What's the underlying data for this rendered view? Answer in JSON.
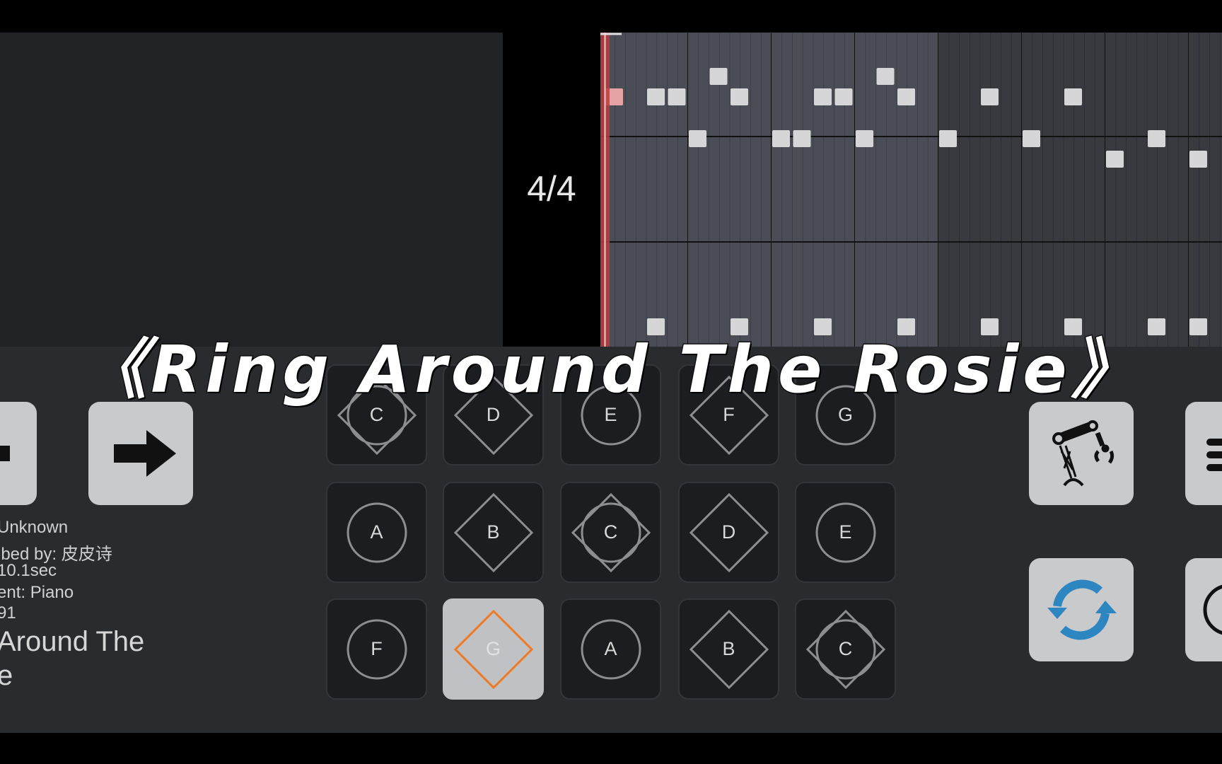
{
  "timeline": {
    "time_signature": "4/4",
    "measures_visible": 8,
    "beats_per_measure": 4,
    "highlighted_measures": 4,
    "notes": [
      {
        "beat": 0,
        "lane": 1,
        "playing": true
      },
      {
        "beat": 2,
        "lane": 1
      },
      {
        "beat": 3,
        "lane": 1
      },
      {
        "beat": 5,
        "lane": 0
      },
      {
        "beat": 6,
        "lane": 1
      },
      {
        "beat": 10,
        "lane": 1
      },
      {
        "beat": 11,
        "lane": 1
      },
      {
        "beat": 13,
        "lane": 0
      },
      {
        "beat": 14,
        "lane": 1
      },
      {
        "beat": 18,
        "lane": 1
      },
      {
        "beat": 22,
        "lane": 1
      },
      {
        "beat": 4,
        "lane": 2
      },
      {
        "beat": 8,
        "lane": 2
      },
      {
        "beat": 9,
        "lane": 2
      },
      {
        "beat": 12,
        "lane": 2
      },
      {
        "beat": 16,
        "lane": 2
      },
      {
        "beat": 20,
        "lane": 2
      },
      {
        "beat": 26,
        "lane": 2
      },
      {
        "beat": 24,
        "lane": 3
      },
      {
        "beat": 28,
        "lane": 3
      },
      {
        "beat": 2,
        "lane": 4
      },
      {
        "beat": 6,
        "lane": 4
      },
      {
        "beat": 10,
        "lane": 4
      },
      {
        "beat": 14,
        "lane": 4
      },
      {
        "beat": 18,
        "lane": 4
      },
      {
        "beat": 22,
        "lane": 4
      },
      {
        "beat": 26,
        "lane": 4
      },
      {
        "beat": 28,
        "lane": 4
      }
    ],
    "playhead_color": "#c0393b"
  },
  "info": {
    "lines": [
      "Unknown",
      "ibed by: 皮皮诗",
      " 10.1sec",
      "ent: Piano",
      "91"
    ],
    "song_title_lines": [
      " Around The",
      "e"
    ]
  },
  "overlay_title": "《Ring Around The Rosie》",
  "keys": [
    {
      "label": "C",
      "shape": "both"
    },
    {
      "label": "D",
      "shape": "diamond"
    },
    {
      "label": "E",
      "shape": "circle"
    },
    {
      "label": "F",
      "shape": "diamond"
    },
    {
      "label": "G",
      "shape": "circle"
    },
    {
      "label": "A",
      "shape": "circle"
    },
    {
      "label": "B",
      "shape": "diamond"
    },
    {
      "label": "C",
      "shape": "both"
    },
    {
      "label": "D",
      "shape": "diamond"
    },
    {
      "label": "E",
      "shape": "circle"
    },
    {
      "label": "F",
      "shape": "circle"
    },
    {
      "label": "G",
      "shape": "diamond",
      "active": true
    },
    {
      "label": "A",
      "shape": "circle"
    },
    {
      "label": "B",
      "shape": "diamond"
    },
    {
      "label": "C",
      "shape": "both"
    }
  ],
  "colors": {
    "active_key_outline": "#f07a24",
    "sync_icon": "#2e86c1",
    "button_bg": "#c9cacc"
  },
  "buttons": {
    "prev": "arrow-left-icon",
    "next": "arrow-right-icon",
    "auto_play": "robot-arm-icon",
    "menu": "menu-icon",
    "sync": "sync-icon",
    "extra": "clock-icon"
  }
}
